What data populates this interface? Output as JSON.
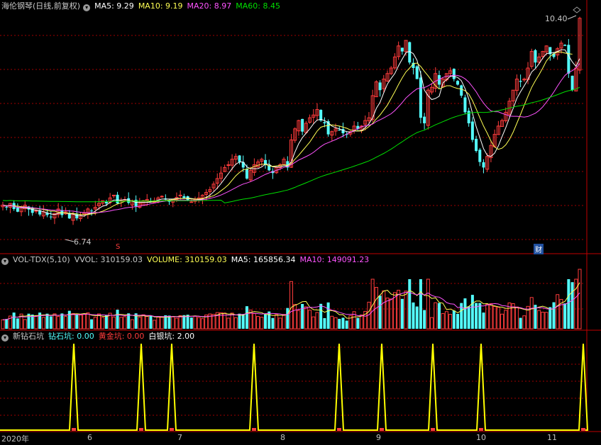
{
  "price_panel": {
    "stock_name": "海伦钢琴(日线,前复权)",
    "ma5": "MA5: 9.29",
    "ma10": "MA10: 9.19",
    "ma20": "MA20: 8.97",
    "ma60": "MA60: 8.45",
    "high_label": "10.40",
    "low_label": "6.74",
    "marker_s": "S",
    "marker_cai": "财"
  },
  "volume_panel": {
    "name": "VOL-TDX(5,10)",
    "vvol": "VVOL: 310159.03",
    "volume": "VOLUME: 310159.03",
    "ma5": "MA5: 165856.34",
    "ma10": "MA10: 149091.23"
  },
  "indicator_panel": {
    "name": "新钻石坑",
    "diamond": "钻石坑: 0.00",
    "gold": "黄金坑: 0.00",
    "silver": "白银坑: 2.00"
  },
  "time_axis": [
    "2020年",
    "6",
    "7",
    "8",
    "9",
    "10",
    "11"
  ],
  "colors": {
    "up": "#ff3c3c",
    "down": "#54ffff",
    "ma5": "#ffffff",
    "ma10": "#ffff54",
    "ma20": "#ff54ff",
    "ma60": "#00e000",
    "silver_line": "#ffff00",
    "grid": "#a00000"
  },
  "chart_data": {
    "type": "candlestick",
    "price_range": [
      6.5,
      10.5
    ],
    "close": [
      7.02,
      6.98,
      7.05,
      6.95,
      6.9,
      6.98,
      7.02,
      6.94,
      6.88,
      6.92,
      6.85,
      6.9,
      6.84,
      6.8,
      6.87,
      6.95,
      6.84,
      6.9,
      6.78,
      6.85,
      6.78,
      6.83,
      6.88,
      6.95,
      6.92,
      6.98,
      7.05,
      7.1,
      7.05,
      7.15,
      7.2,
      7.05,
      7.1,
      7.12,
      7.06,
      7.1,
      7.0,
      7.05,
      7.1,
      7.12,
      7.08,
      7.1,
      7.15,
      7.18,
      7.12,
      7.08,
      7.12,
      7.16,
      7.2,
      7.15,
      7.1,
      7.08,
      7.12,
      7.15,
      7.2,
      7.25,
      7.3,
      7.4,
      7.5,
      7.6,
      7.7,
      7.75,
      7.85,
      7.9,
      7.8,
      7.7,
      7.5,
      7.65,
      7.75,
      7.8,
      7.85,
      7.75,
      7.65,
      7.6,
      7.7,
      7.75,
      7.85,
      7.7,
      8.2,
      8.4,
      8.55,
      8.35,
      8.5,
      8.6,
      8.65,
      8.75,
      8.55,
      8.5,
      8.3,
      8.35,
      8.4,
      8.38,
      8.32,
      8.3,
      8.35,
      8.45,
      8.4,
      8.45,
      8.55,
      8.6,
      9.0,
      9.25,
      9.1,
      9.3,
      9.4,
      9.5,
      9.7,
      9.9,
      9.8,
      10.0,
      9.6,
      9.5,
      9.3,
      8.6,
      8.5,
      9.1,
      9.15,
      9.4,
      9.2,
      9.3,
      9.4,
      9.45,
      9.3,
      9.2,
      9.0,
      8.7,
      8.5,
      8.2,
      8.0,
      7.8,
      7.7,
      7.9,
      8.1,
      8.3,
      8.45,
      8.55,
      8.7,
      8.9,
      9.1,
      9.3,
      9.25,
      9.3,
      9.5,
      9.8,
      9.6,
      9.7,
      9.8,
      9.9,
      9.75,
      9.7,
      9.85,
      9.95,
      9.9,
      9.4,
      9.1,
      9.5,
      10.4
    ],
    "ma5": [
      7.02,
      7.0,
      7.01,
      7.0,
      6.98,
      6.97,
      6.97,
      6.96,
      6.94,
      6.93,
      6.92,
      6.9,
      6.88,
      6.86,
      6.85,
      6.87,
      6.88,
      6.88,
      6.86,
      6.86,
      6.83,
      6.83,
      6.82,
      6.86,
      6.87,
      6.91,
      6.96,
      7.0,
      7.02,
      7.07,
      7.11,
      7.11,
      7.11,
      7.12,
      7.11,
      7.09,
      7.07,
      7.07,
      7.07,
      7.07,
      7.07,
      7.09,
      7.11,
      7.13,
      7.13,
      7.13,
      7.13,
      7.14,
      7.14,
      7.14,
      7.15,
      7.14,
      7.13,
      7.12,
      7.13,
      7.16,
      7.2,
      7.26,
      7.33,
      7.41,
      7.5,
      7.59,
      7.68,
      7.76,
      7.8,
      7.8,
      7.71,
      7.68,
      7.68,
      7.68,
      7.71,
      7.76,
      7.76,
      7.71,
      7.71,
      7.71,
      7.73,
      7.73,
      7.8,
      7.98,
      8.13,
      8.24,
      8.32,
      8.4,
      8.49,
      8.56,
      8.57,
      8.55,
      8.51,
      8.45,
      8.42,
      8.4,
      8.37,
      8.35,
      8.34,
      8.36,
      8.36,
      8.37,
      8.42,
      8.49,
      8.6,
      8.77,
      8.88,
      9.05,
      9.21,
      9.31,
      9.4,
      9.54,
      9.66,
      9.78,
      9.8,
      9.76,
      9.64,
      9.4,
      9.1,
      9.0,
      8.93,
      8.95,
      8.99,
      9.23,
      9.29,
      9.35,
      9.35,
      9.33,
      9.27,
      9.13,
      8.94,
      8.68,
      8.44,
      8.24,
      8.04,
      7.92,
      7.9,
      7.96,
      8.09,
      8.26,
      8.42,
      8.6,
      8.77,
      8.95,
      9.07,
      9.18,
      9.29,
      9.43,
      9.49,
      9.58,
      9.68,
      9.76,
      9.77,
      9.78,
      9.8,
      9.83,
      9.83,
      9.72,
      9.61,
      9.53,
      9.67
    ],
    "ma10": [
      7.02,
      7.01,
      7.01,
      7.01,
      7.0,
      6.99,
      6.99,
      6.98,
      6.96,
      6.96,
      6.95,
      6.94,
      6.92,
      6.91,
      6.91,
      6.89,
      6.88,
      6.88,
      6.87,
      6.87,
      6.86,
      6.85,
      6.85,
      6.85,
      6.86,
      6.87,
      6.89,
      6.91,
      6.94,
      6.97,
      7.01,
      7.04,
      7.06,
      7.09,
      7.09,
      7.1,
      7.09,
      7.09,
      7.1,
      7.09,
      7.08,
      7.08,
      7.09,
      7.1,
      7.1,
      7.11,
      7.12,
      7.13,
      7.14,
      7.14,
      7.14,
      7.13,
      7.13,
      7.13,
      7.14,
      7.15,
      7.17,
      7.19,
      7.23,
      7.28,
      7.33,
      7.39,
      7.47,
      7.55,
      7.61,
      7.66,
      7.67,
      7.69,
      7.72,
      7.74,
      7.76,
      7.76,
      7.73,
      7.72,
      7.73,
      7.74,
      7.75,
      7.74,
      7.77,
      7.85,
      7.92,
      8.0,
      8.08,
      8.16,
      8.26,
      8.36,
      8.43,
      8.45,
      8.46,
      8.47,
      8.46,
      8.45,
      8.43,
      8.41,
      8.38,
      8.37,
      8.36,
      8.36,
      8.39,
      8.44,
      8.5,
      8.58,
      8.65,
      8.74,
      8.83,
      8.95,
      9.07,
      9.2,
      9.32,
      9.43,
      9.5,
      9.58,
      9.59,
      9.53,
      9.44,
      9.36,
      9.27,
      9.18,
      9.12,
      9.15,
      9.18,
      9.18,
      9.15,
      9.13,
      9.12,
      9.09,
      9.03,
      8.91,
      8.76,
      8.6,
      8.45,
      8.32,
      8.18,
      8.07,
      8.03,
      8.05,
      8.11,
      8.21,
      8.34,
      8.5,
      8.66,
      8.83,
      8.99,
      9.15,
      9.27,
      9.38,
      9.5,
      9.63,
      9.71,
      9.76,
      9.79,
      9.79,
      9.77,
      9.76,
      9.75
    ]
  }
}
